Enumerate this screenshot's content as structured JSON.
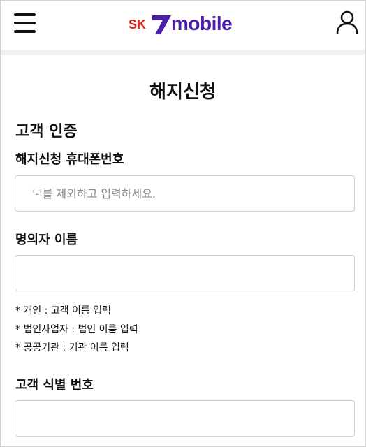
{
  "header": {
    "logo": {
      "sk": "SK",
      "brand": "mobile"
    },
    "menu_icon": "hamburger-icon",
    "user_icon": "user-icon"
  },
  "page": {
    "title": "해지신청"
  },
  "form": {
    "section_title": "고객 인증",
    "phone": {
      "label": "해지신청 휴대폰번호",
      "placeholder": "'-'를 제외하고 입력하세요.",
      "value": ""
    },
    "name": {
      "label": "명의자 이름",
      "placeholder": "",
      "value": ""
    },
    "notes": [
      "* 개인 : 고객 이름 입력",
      "* 법인사업자 : 법인 이름 입력",
      "* 공공기관 : 기관 이름 입력"
    ],
    "customer_id": {
      "label": "고객 식별 번호",
      "placeholder": "",
      "value": ""
    }
  },
  "colors": {
    "sk_red": "#e2231a",
    "brand_purple": "#4b1fa8",
    "divider": "#efefef",
    "border": "#cfcfcf"
  }
}
